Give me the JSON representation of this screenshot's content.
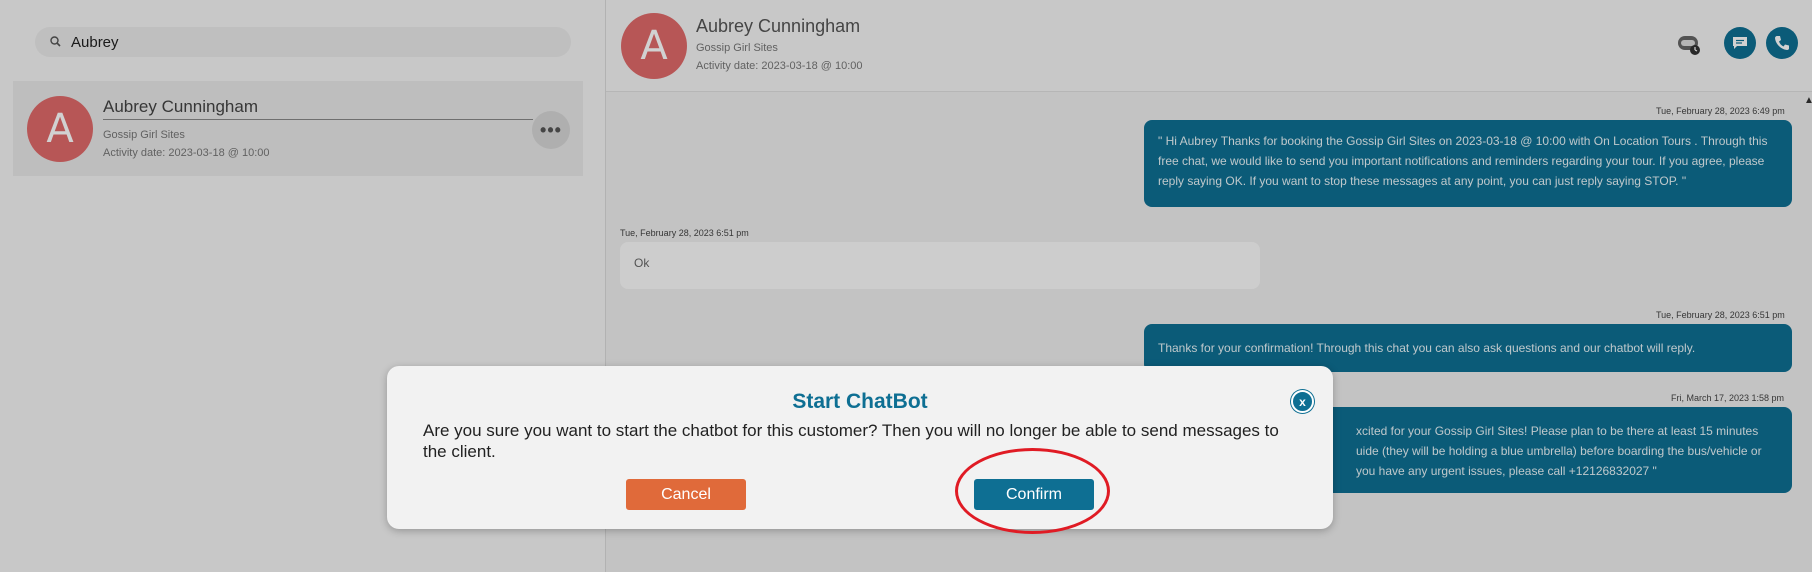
{
  "search": {
    "value": "Aubrey"
  },
  "contact": {
    "initial": "A",
    "name": "Aubrey Cunningham",
    "site": "Gossip Girl Sites",
    "activity": "Activity date: 2023-03-18 @ 10:00",
    "more_label": "•••"
  },
  "header": {
    "initial": "A",
    "name": "Aubrey Cunningham",
    "site": "Gossip Girl Sites",
    "activity": "Activity date: 2023-03-18 @ 10:00"
  },
  "messages": [
    {
      "direction": "out",
      "time": "Tue, February 28, 2023 6:49 pm",
      "text": "\" Hi Aubrey Thanks for booking the Gossip Girl Sites on 2023-03-18 @ 10:00 with On Location Tours . Through this free chat, we would like to send you important notifications and reminders regarding your tour. If you agree, please reply saying OK. If you want to stop these messages at any point, you can just reply saying STOP. \""
    },
    {
      "direction": "in",
      "time": "Tue, February 28, 2023 6:51 pm",
      "text": "Ok"
    },
    {
      "direction": "out",
      "time": "Tue, February 28, 2023 6:51 pm",
      "text": "Thanks for your confirmation! Through this chat you can also ask questions and our chatbot will reply."
    },
    {
      "direction": "out",
      "time": "Fri, March 17, 2023 1:58 pm",
      "line1": "xcited for your Gossip Girl Sites! Please plan to be there at least 15 minutes",
      "line2": "uide (they will be holding a blue umbrella) before boarding the bus/vehicle or",
      "line3": "you have any urgent issues, please call +12126832027 \""
    }
  ],
  "modal": {
    "title": "Start ChatBot",
    "close_label": "x",
    "text": "Are you sure you want to start the chatbot for this customer? Then you will no longer be able to send messages to the client.",
    "cancel_label": "Cancel",
    "confirm_label": "Confirm"
  },
  "colors": {
    "accent": "#0e6f93",
    "cancel": "#e06a3a",
    "avatar": "#e06a6a",
    "annotation": "#e01b24"
  }
}
